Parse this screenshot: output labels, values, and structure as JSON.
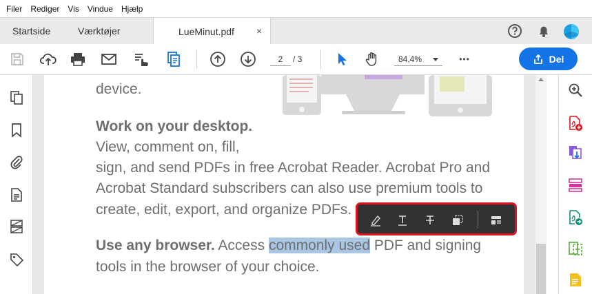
{
  "menu": [
    "Filer",
    "Rediger",
    "Vis",
    "Vindue",
    "Hjælp"
  ],
  "tabs": {
    "home": "Startside",
    "tools": "Værktøjer",
    "document": "LueMinut.pdf",
    "close": "×"
  },
  "toolbar": {
    "page_current": "2",
    "page_total": "/ 3",
    "zoom": "84,4%",
    "more": "•••",
    "share_label": "Del"
  },
  "document": {
    "line_device": "device.",
    "heading_desktop": "Work on your desktop.",
    "desktop_line1": "View, comment on, fill,",
    "desktop_line2": "sign, and send PDFs in free Acrobat Reader. Acrobat Pro and",
    "desktop_line3": "Acrobat Standard subscribers can also use premium tools to",
    "desktop_line4": "create, edit, export, and organize PDFs.",
    "heading_browser": "Use any browser.",
    "browser_pre": " Access ",
    "browser_highlight": "commonly used",
    "browser_post": " PDF and signing",
    "browser_line2": "tools in the browser of your choice."
  },
  "colors": {
    "accent": "#1473e6",
    "highlight": "#a9c7e4",
    "floatbar_bg": "#323232",
    "floatbar_border": "#e0141e"
  }
}
